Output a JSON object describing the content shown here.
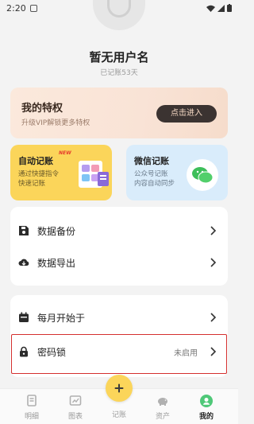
{
  "status_bar": {
    "time": "2:20"
  },
  "profile": {
    "username": "暂无用户名",
    "recorded_days": "已记账53天"
  },
  "privilege": {
    "title": "我的特权",
    "subtitle": "升级VIP解锁更多特权",
    "button": "点击进入"
  },
  "features": {
    "auto": {
      "title": "自动记账",
      "badge": "NEW",
      "desc_line1": "通过快捷指令",
      "desc_line2": "快速记账"
    },
    "wechat": {
      "title": "微信记账",
      "desc_line1": "公众号记账",
      "desc_line2": "内容自动同步"
    }
  },
  "settings_1": [
    {
      "label": "数据备份",
      "icon": "save-icon"
    },
    {
      "label": "数据导出",
      "icon": "cloud-download-icon"
    }
  ],
  "settings_2": [
    {
      "label": "每月开始于",
      "icon": "calendar-icon",
      "value": ""
    },
    {
      "label": "密码锁",
      "icon": "lock-icon",
      "value": "未启用"
    }
  ],
  "tabbar": {
    "tabs": [
      {
        "label": "明细",
        "icon": "receipt-icon"
      },
      {
        "label": "图表",
        "icon": "chart-icon"
      },
      {
        "label": "记账",
        "icon": "plus-icon"
      },
      {
        "label": "资产",
        "icon": "piggy-bank-icon"
      },
      {
        "label": "我的",
        "icon": "user-icon"
      }
    ],
    "active": "我的"
  },
  "colors": {
    "accent_yellow": "#fbd55a",
    "highlight_red": "#d4302f",
    "privilege_button": "#3b3331"
  }
}
